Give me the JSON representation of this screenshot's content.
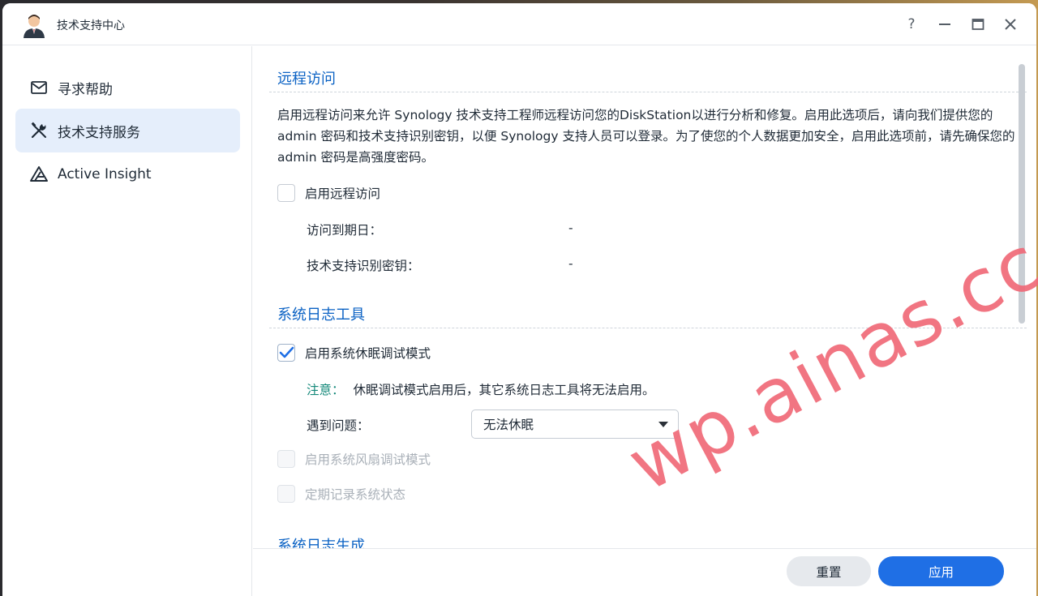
{
  "window": {
    "title": "技术支持中心",
    "controls": {
      "help": "?",
      "minimize": "—",
      "maximize": "□",
      "close": "✕"
    }
  },
  "sidebar": {
    "items": [
      {
        "label": "寻求帮助",
        "icon": "mail-icon",
        "active": false
      },
      {
        "label": "技术支持服务",
        "icon": "tools-icon",
        "active": true
      },
      {
        "label": "Active Insight",
        "icon": "active-insight-icon",
        "active": false
      }
    ]
  },
  "remote_access": {
    "title": "远程访问",
    "description": "启用远程访问来允许 Synology 技术支持工程师远程访问您的DiskStation以进行分析和修复。启用此选项后，请向我们提供您的 admin 密码和技术支持识别密钥，以便 Synology 支持人员可以登录。为了使您的个人数据更加安全，启用此选项前，请先确保您的 admin 密码是高强度密码。",
    "enable_label": "启用远程访问",
    "enabled": false,
    "expiry_label": "访问到期日：",
    "expiry_value": "-",
    "key_label": "技术支持识别密钥：",
    "key_value": "-"
  },
  "syslog_tools": {
    "title": "系统日志工具",
    "hibernation_debug_label": "启用系统休眠调试模式",
    "hibernation_debug_checked": true,
    "note_label": "注意：",
    "note_text": "休眠调试模式启用后，其它系统日志工具将无法启用。",
    "problem_label": "遇到问题：",
    "problem_selected": "无法休眠",
    "fan_debug_label": "启用系统风扇调试模式",
    "record_status_label": "定期记录系统状态"
  },
  "syslog_gen": {
    "title": "系统日志生成"
  },
  "footer": {
    "reset_label": "重置",
    "apply_label": "应用"
  },
  "watermark": "wp.ainas.cc",
  "colors": {
    "accent": "#1f6fe5",
    "section_title": "#0b62c4",
    "active_nav_bg": "#e5eefb",
    "note": "#15897a",
    "watermark": "#f06a78"
  }
}
